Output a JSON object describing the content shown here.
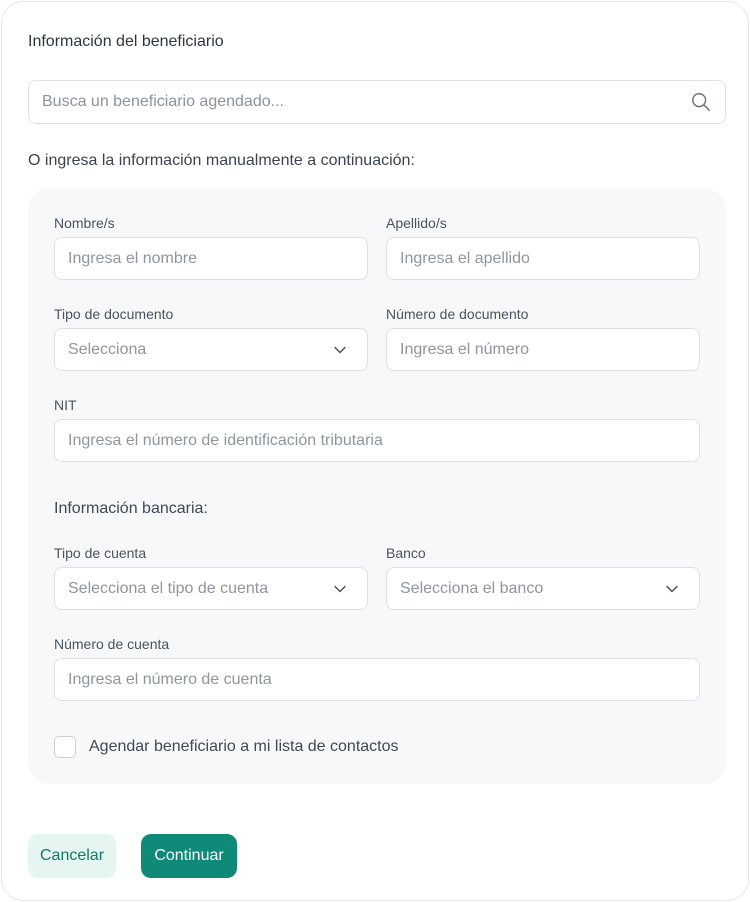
{
  "form": {
    "title": "Información del beneficiario",
    "search": {
      "placeholder": "Busca un beneficiario agendado...",
      "icon": "search-icon"
    },
    "manual_prompt": "O ingresa la información manualmente a continuación:",
    "fields": {
      "first_name": {
        "label": "Nombre/s",
        "placeholder": "Ingresa el nombre"
      },
      "last_name": {
        "label": "Apellido/s",
        "placeholder": "Ingresa el apellido"
      },
      "doc_type": {
        "label": "Tipo de documento",
        "value": "Selecciona",
        "icon": "chevron-down-icon"
      },
      "doc_number": {
        "label": "Número de documento",
        "placeholder": "Ingresa el número"
      },
      "nit": {
        "label": "NIT",
        "placeholder": "Ingresa el número de identificación tributaria"
      },
      "bank_section": "Información bancaria:",
      "account_type": {
        "label": "Tipo de cuenta",
        "value": "Selecciona el tipo de cuenta",
        "icon": "chevron-down-icon"
      },
      "bank": {
        "label": "Banco",
        "value": "Selecciona el banco",
        "icon": "chevron-down-icon"
      },
      "account_number": {
        "label": "Número de cuenta",
        "placeholder": "Ingresa el número de cuenta"
      }
    },
    "save_contact": {
      "label": "Agendar beneficiario a mi lista de contactos",
      "checked": false
    },
    "actions": {
      "cancel": "Cancelar",
      "continue": "Continuar"
    }
  },
  "colors": {
    "primary": "#0f8a78",
    "primary_light": "#e4f5f2",
    "panel": "#f6f8fa",
    "border": "#dde1e6"
  }
}
